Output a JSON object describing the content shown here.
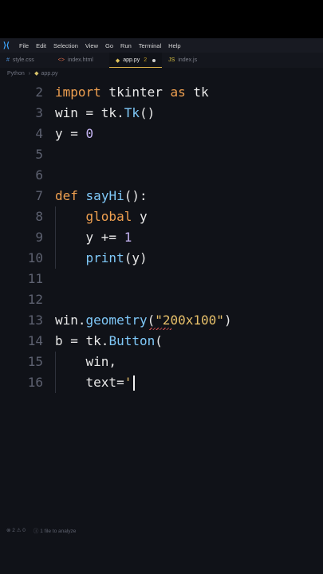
{
  "menubar": {
    "items": [
      "File",
      "Edit",
      "Selection",
      "View",
      "Go",
      "Run",
      "Terminal",
      "Help"
    ]
  },
  "tabs": [
    {
      "label": "style.css",
      "icon": "#",
      "icon_color": "#4c8fd6"
    },
    {
      "label": "index.html",
      "icon": "<>",
      "icon_color": "#e06c4a"
    },
    {
      "label": "app.py",
      "icon": "◆",
      "icon_color": "#e0c35a",
      "count": "2",
      "active": true,
      "modified": true
    },
    {
      "label": "index.js",
      "icon": "JS",
      "icon_color": "#d8c040"
    }
  ],
  "breadcrumb": {
    "folder": "Python",
    "file": "app.py"
  },
  "editor": {
    "lines": [
      {
        "n": "2",
        "segs": [
          [
            "kw",
            "import"
          ],
          [
            "t",
            " tkinter "
          ],
          [
            "kw",
            "as"
          ],
          [
            "t",
            " tk"
          ]
        ]
      },
      {
        "n": "3",
        "segs": [
          [
            "t",
            "win = tk."
          ],
          [
            "fn",
            "Tk"
          ],
          [
            "t",
            "()"
          ]
        ]
      },
      {
        "n": "4",
        "segs": [
          [
            "t",
            "y = "
          ],
          [
            "num",
            "0"
          ]
        ]
      },
      {
        "n": "5",
        "segs": []
      },
      {
        "n": "6",
        "segs": []
      },
      {
        "n": "7",
        "segs": [
          [
            "kw",
            "def"
          ],
          [
            "t",
            " "
          ],
          [
            "fn",
            "sayHi"
          ],
          [
            "t",
            "():"
          ]
        ]
      },
      {
        "n": "8",
        "segs": [
          [
            "ind",
            "    "
          ],
          [
            "kw",
            "global"
          ],
          [
            "t",
            " y"
          ]
        ]
      },
      {
        "n": "9",
        "segs": [
          [
            "ind",
            "    "
          ],
          [
            "t",
            "y += "
          ],
          [
            "num",
            "1"
          ]
        ]
      },
      {
        "n": "10",
        "segs": [
          [
            "ind",
            "    "
          ],
          [
            "fn",
            "print"
          ],
          [
            "t",
            "(y)"
          ]
        ]
      },
      {
        "n": "11",
        "segs": []
      },
      {
        "n": "12",
        "segs": []
      },
      {
        "n": "13",
        "segs": [
          [
            "t",
            "win."
          ],
          [
            "fn",
            "geometry"
          ],
          [
            "t",
            "("
          ],
          [
            "str",
            "\"200x100\""
          ],
          [
            "t",
            ")"
          ]
        ]
      },
      {
        "n": "14",
        "segs": [
          [
            "t",
            "b = tk."
          ],
          [
            "fn",
            "Button"
          ],
          [
            "t",
            "("
          ]
        ]
      },
      {
        "n": "15",
        "segs": [
          [
            "ind",
            "    "
          ],
          [
            "t",
            "win,"
          ]
        ]
      },
      {
        "n": "16",
        "segs": [
          [
            "ind",
            "    "
          ],
          [
            "t",
            "text="
          ],
          [
            "str",
            "'"
          ]
        ],
        "cursor": true
      }
    ]
  },
  "status": {
    "problems": "⊗ 2 ⚠ 0",
    "analysis": "ⓘ 1 file to analyze"
  },
  "colors": {
    "keyword": "#f0a050",
    "function": "#7fc8f8",
    "number": "#c5b4f2",
    "string": "#e7c06a"
  }
}
